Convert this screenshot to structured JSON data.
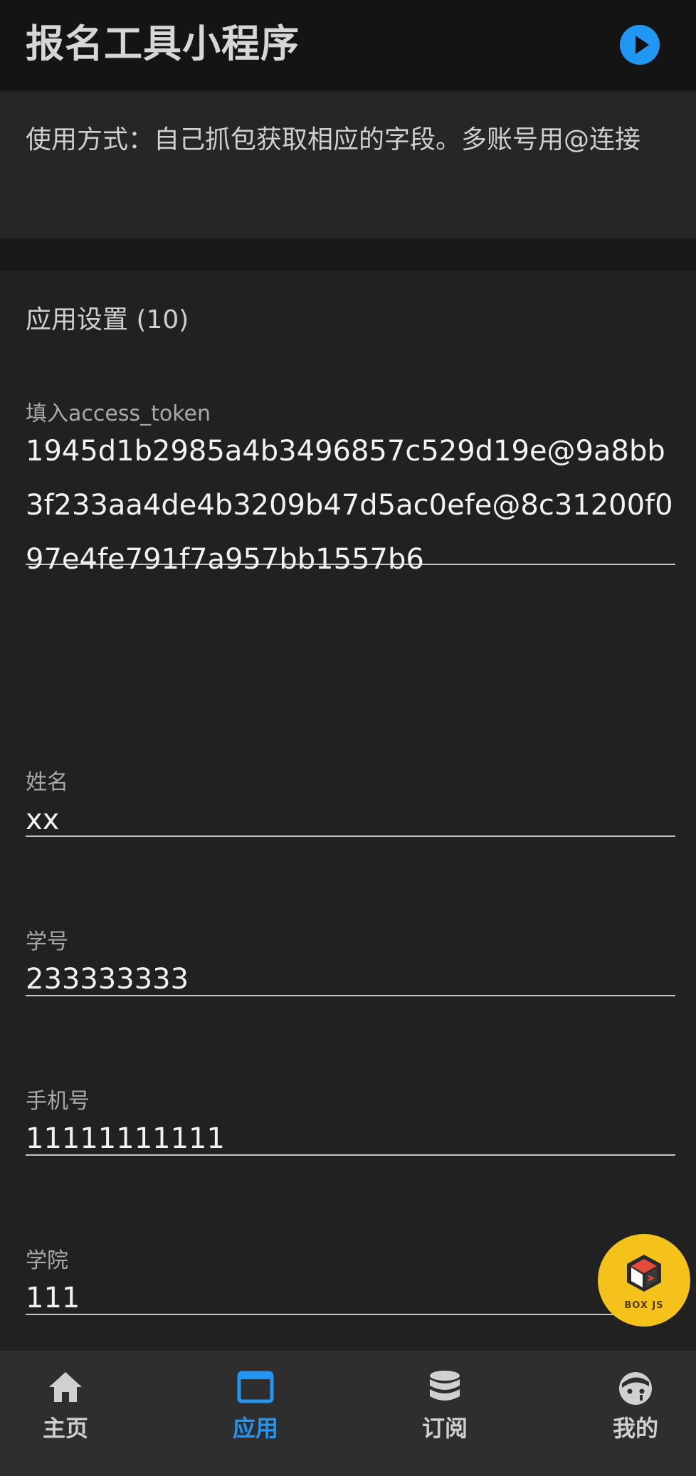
{
  "header": {
    "title": "报名工具小程序",
    "run_icon": "play-circle-icon"
  },
  "description": {
    "text": "使用方式：自己抓包获取相应的字段。多账号用@连接"
  },
  "settings": {
    "title": "应用设置 (10)",
    "fields": [
      {
        "label": "填入access_token",
        "value": "1945d1b2985a4b3496857c529d19e@9a8bb3f233aa4de4b3209b47d5ac0efe@8c31200f097e4fe791f7a957bb1557b6"
      },
      {
        "label": "姓名",
        "value": "xx"
      },
      {
        "label": "学号",
        "value": "233333333"
      },
      {
        "label": "手机号",
        "value": "11111111111"
      },
      {
        "label": "学院",
        "value": "111"
      }
    ]
  },
  "fab": {
    "label": "BOX JS",
    "icon": "boxjs-logo-icon"
  },
  "nav": {
    "items": [
      {
        "label": "主页",
        "icon": "home-icon"
      },
      {
        "label": "应用",
        "icon": "app-window-icon",
        "active": true
      },
      {
        "label": "订阅",
        "icon": "database-icon"
      },
      {
        "label": "我的",
        "icon": "profile-face-icon"
      }
    ]
  },
  "colors": {
    "accent": "#2196f3",
    "fab": "#f4c21b",
    "background": "#1f1f1f"
  }
}
